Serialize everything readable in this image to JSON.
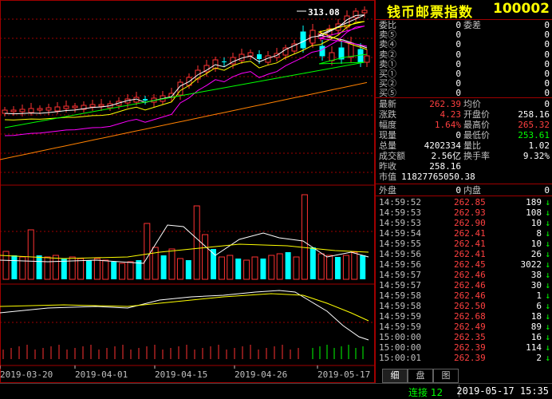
{
  "header": {
    "name": "钱币邮票指数",
    "code": "100002"
  },
  "order_book": [
    {
      "label": "委比",
      "value": "0",
      "label2": "委差",
      "value2": "0"
    },
    {
      "label": "卖⑤",
      "value": "0",
      "label2": "",
      "value2": "0"
    },
    {
      "label": "卖④",
      "value": "0",
      "label2": "",
      "value2": "0"
    },
    {
      "label": "卖②",
      "value": "0",
      "label2": "",
      "value2": "0"
    },
    {
      "label": "卖①",
      "value": "0",
      "label2": "",
      "value2": "0"
    },
    {
      "label": "买①",
      "value": "0",
      "label2": "",
      "value2": "0"
    },
    {
      "label": "买②",
      "value": "0",
      "label2": "",
      "value2": "0"
    },
    {
      "label": "买⑤",
      "value": "0",
      "label2": "",
      "value2": "0"
    }
  ],
  "quote": [
    {
      "label": "最新",
      "value": "262.39",
      "vcolor": "red",
      "label2": "均价",
      "value2": "0",
      "v2color": "wht"
    },
    {
      "label": "涨跌",
      "value": "4.23",
      "vcolor": "red",
      "label2": "开盘价",
      "value2": "258.16",
      "v2color": "wht"
    },
    {
      "label": "幅度",
      "value": "1.64%",
      "vcolor": "red",
      "label2": "最高价",
      "value2": "265.32",
      "v2color": "red"
    },
    {
      "label": "现量",
      "value": "0",
      "vcolor": "wht",
      "label2": "最低价",
      "value2": "253.61",
      "v2color": "grn"
    },
    {
      "label": "总量",
      "value": "4202334",
      "vcolor": "wht",
      "label2": "量比",
      "value2": "1.02",
      "v2color": "wht"
    },
    {
      "label": "成交额",
      "value": "2.56亿",
      "vcolor": "wht",
      "label2": "换手率",
      "value2": "9.32%",
      "v2color": "wht"
    },
    {
      "label": "昨收",
      "value": "258.16",
      "vcolor": "wht",
      "label2": "",
      "value2": "",
      "v2color": "wht"
    },
    {
      "label": "市值",
      "value": "11827765050.38",
      "vcolor": "wht",
      "label2": "",
      "value2": "",
      "v2color": "wht"
    }
  ],
  "outer_inner": {
    "label": "外盘",
    "value": "0",
    "label2": "内盘",
    "value2": "0"
  },
  "ticks": [
    {
      "time": "14:59:52",
      "price": "262.85",
      "qty": "189",
      "dir": "↓"
    },
    {
      "time": "14:59:53",
      "price": "262.93",
      "qty": "108",
      "dir": "↓"
    },
    {
      "time": "14:59:53",
      "price": "262.90",
      "qty": "10",
      "dir": "↓"
    },
    {
      "time": "14:59:54",
      "price": "262.41",
      "qty": "8",
      "dir": "↓"
    },
    {
      "time": "14:59:55",
      "price": "262.41",
      "qty": "10",
      "dir": "↓"
    },
    {
      "time": "14:59:56",
      "price": "262.41",
      "qty": "26",
      "dir": "↓"
    },
    {
      "time": "14:59:56",
      "price": "262.45",
      "qty": "3022",
      "dir": "↓"
    },
    {
      "time": "14:59:57",
      "price": "262.46",
      "qty": "38",
      "dir": "↓"
    },
    {
      "time": "14:59:57",
      "price": "262.46",
      "qty": "30",
      "dir": "↓"
    },
    {
      "time": "14:59:58",
      "price": "262.46",
      "qty": "1",
      "dir": "↓"
    },
    {
      "time": "14:59:58",
      "price": "262.50",
      "qty": "6",
      "dir": "↓"
    },
    {
      "time": "14:59:59",
      "price": "262.68",
      "qty": "18",
      "dir": "↓"
    },
    {
      "time": "14:59:59",
      "price": "262.49",
      "qty": "89",
      "dir": "↓"
    },
    {
      "time": "15:00:00",
      "price": "262.35",
      "qty": "16",
      "dir": "↓"
    },
    {
      "time": "15:00:00",
      "price": "262.39",
      "qty": "114",
      "dir": "↓"
    },
    {
      "time": "15:00:01",
      "price": "262.39",
      "qty": "2",
      "dir": "↓"
    }
  ],
  "tabs": [
    "细",
    "盘",
    "图"
  ],
  "status": {
    "connection": "连接 12",
    "datetime": "2019-05-17 15:35"
  },
  "chart_data": {
    "type": "candlestick",
    "high_label": "313.08",
    "x_labels": [
      "2019-03-20",
      "2019-04-01",
      "2019-04-15",
      "2019-04-26",
      "2019-05-17"
    ],
    "colors": {
      "up": "#ff3232",
      "down": "#00ffff",
      "ma1": "#ffffff",
      "ma2": "#ffff00",
      "ma3": "#ff00ff",
      "ma4": "#00ff00",
      "ma5": "#ff8000"
    }
  }
}
